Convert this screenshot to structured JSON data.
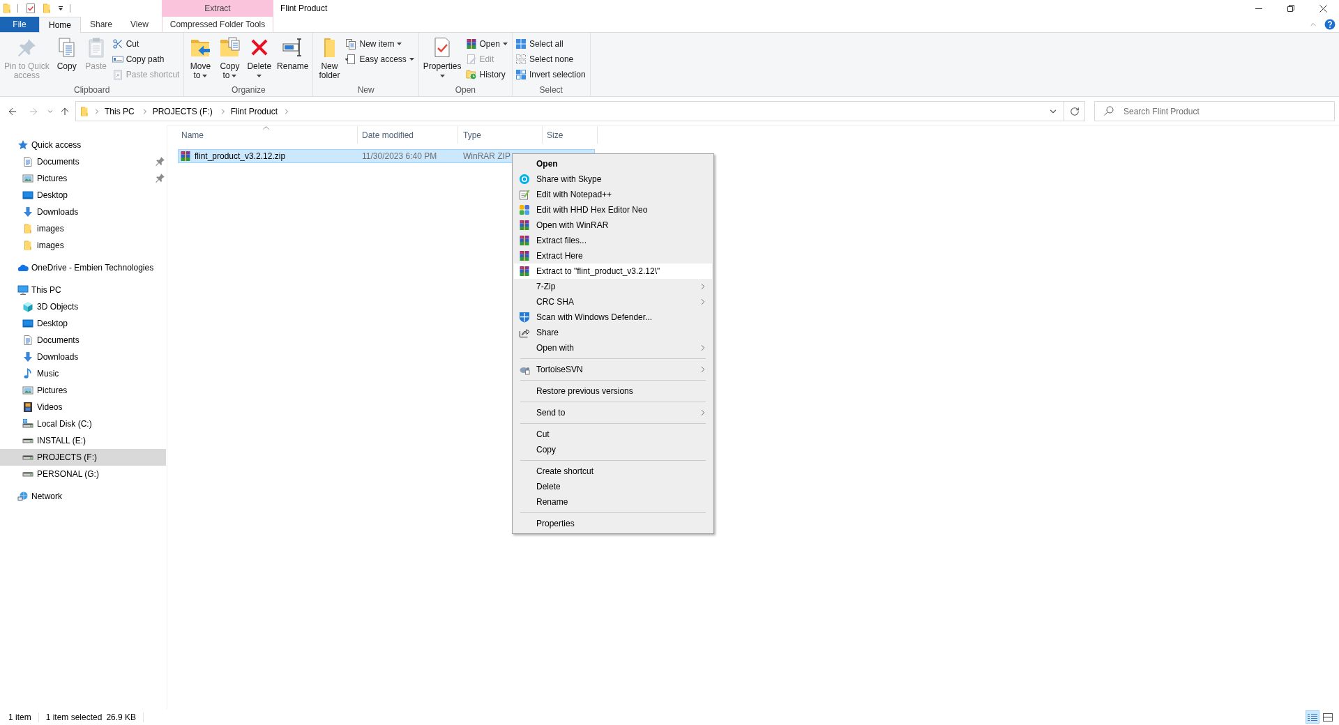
{
  "title_bar": {
    "contextual_group": "Extract",
    "title": "Flint Product"
  },
  "ribbon_tabs": [
    {
      "label": "File",
      "kind": "file",
      "selected": false
    },
    {
      "label": "Home",
      "kind": "tab",
      "selected": true
    },
    {
      "label": "Share",
      "kind": "tab",
      "selected": false
    },
    {
      "label": "View",
      "kind": "tab",
      "selected": false
    },
    {
      "label": "Compressed Folder Tools",
      "kind": "contextual",
      "selected": false
    }
  ],
  "ribbon_groups": [
    {
      "label": "Clipboard",
      "buttons": [
        {
          "label": "Pin to Quick access",
          "kind": "large",
          "disabled": true,
          "dropdown": false
        },
        {
          "label": "Copy",
          "kind": "large",
          "disabled": false,
          "dropdown": false
        },
        {
          "label": "Paste",
          "kind": "large",
          "disabled": true,
          "dropdown": false
        },
        {
          "label": "Cut",
          "kind": "small",
          "disabled": false,
          "dropdown": false
        },
        {
          "label": "Copy path",
          "kind": "small",
          "disabled": false,
          "dropdown": false
        },
        {
          "label": "Paste shortcut",
          "kind": "small",
          "disabled": true,
          "dropdown": false
        }
      ]
    },
    {
      "label": "Organize",
      "buttons": [
        {
          "label": "Move to",
          "kind": "large",
          "disabled": false,
          "dropdown": true
        },
        {
          "label": "Copy to",
          "kind": "large",
          "disabled": false,
          "dropdown": true
        },
        {
          "label": "Delete",
          "kind": "large",
          "disabled": false,
          "dropdown": true
        },
        {
          "label": "Rename",
          "kind": "large",
          "disabled": false,
          "dropdown": false
        }
      ]
    },
    {
      "label": "New",
      "buttons": [
        {
          "label": "New folder",
          "kind": "large",
          "disabled": false,
          "dropdown": false
        },
        {
          "label": "New item",
          "kind": "small",
          "disabled": false,
          "dropdown": true
        },
        {
          "label": "Easy access",
          "kind": "small",
          "disabled": false,
          "dropdown": true
        }
      ]
    },
    {
      "label": "Open",
      "buttons": [
        {
          "label": "Properties",
          "kind": "large",
          "disabled": false,
          "dropdown": true
        },
        {
          "label": "Open",
          "kind": "small",
          "disabled": false,
          "dropdown": true
        },
        {
          "label": "Edit",
          "kind": "small",
          "disabled": true,
          "dropdown": false
        },
        {
          "label": "History",
          "kind": "small",
          "disabled": false,
          "dropdown": false
        }
      ]
    },
    {
      "label": "Select",
      "buttons": [
        {
          "label": "Select all",
          "kind": "small",
          "disabled": false,
          "dropdown": false
        },
        {
          "label": "Select none",
          "kind": "small",
          "disabled": false,
          "dropdown": false
        },
        {
          "label": "Invert selection",
          "kind": "small",
          "disabled": false,
          "dropdown": false
        }
      ]
    }
  ],
  "navigation": {
    "back": {
      "disabled": false
    },
    "forward": {
      "disabled": true
    }
  },
  "address_bar": {
    "breadcrumbs": [
      "This PC",
      "PROJECTS (F:)",
      "Flint Product"
    ]
  },
  "search": {
    "placeholder": "Search Flint Product"
  },
  "navigation_pane": [
    {
      "label": "Quick access",
      "selected": false,
      "children": [
        {
          "label": "Documents",
          "selected": false,
          "pinned": true
        },
        {
          "label": "Pictures",
          "selected": false,
          "pinned": true
        },
        {
          "label": "Desktop",
          "selected": false,
          "pinned": false
        },
        {
          "label": "Downloads",
          "selected": false,
          "pinned": false
        },
        {
          "label": "images",
          "selected": false,
          "pinned": false
        },
        {
          "label": "images",
          "selected": false,
          "pinned": false
        }
      ]
    },
    {
      "label": "OneDrive - Embien Technologies",
      "selected": false
    },
    {
      "label": "This PC",
      "selected": false,
      "children": [
        {
          "label": "3D Objects",
          "selected": false
        },
        {
          "label": "Desktop",
          "selected": false
        },
        {
          "label": "Documents",
          "selected": false
        },
        {
          "label": "Downloads",
          "selected": false
        },
        {
          "label": "Music",
          "selected": false
        },
        {
          "label": "Pictures",
          "selected": false
        },
        {
          "label": "Videos",
          "selected": false
        },
        {
          "label": "Local Disk (C:)",
          "selected": false
        },
        {
          "label": "INSTALL (E:)",
          "selected": false
        },
        {
          "label": "PROJECTS (F:)",
          "selected": true
        },
        {
          "label": "PERSONAL (G:)",
          "selected": false
        }
      ]
    },
    {
      "label": "Network",
      "selected": false
    }
  ],
  "file_list": {
    "columns": [
      {
        "label": "Name",
        "sorted": true
      },
      {
        "label": "Date modified",
        "sorted": false
      },
      {
        "label": "Type",
        "sorted": false
      },
      {
        "label": "Size",
        "sorted": false
      }
    ],
    "rows": [
      {
        "name": "flint_product_v3.2.12.zip",
        "date_modified": "11/30/2023 6:40 PM",
        "type": "WinRAR ZIP",
        "selected": true
      }
    ]
  },
  "context_menu": {
    "sections": [
      {
        "items": [
          {
            "label": "Open",
            "default": true,
            "submenu": false,
            "highlighted": false
          },
          {
            "label": "Share with Skype",
            "default": false,
            "submenu": false,
            "highlighted": false
          },
          {
            "label": "Edit with Notepad++",
            "default": false,
            "submenu": false,
            "highlighted": false
          },
          {
            "label": "Edit with HHD Hex Editor Neo",
            "default": false,
            "submenu": false,
            "highlighted": false
          },
          {
            "label": "Open with WinRAR",
            "default": false,
            "submenu": false,
            "highlighted": false
          },
          {
            "label": "Extract files...",
            "default": false,
            "submenu": false,
            "highlighted": false
          },
          {
            "label": "Extract Here",
            "default": false,
            "submenu": false,
            "highlighted": false
          },
          {
            "label": "Extract to \"flint_product_v3.2.12\\\"",
            "default": false,
            "submenu": false,
            "highlighted": true
          },
          {
            "label": "7-Zip",
            "default": false,
            "submenu": true,
            "highlighted": false
          },
          {
            "label": "CRC SHA",
            "default": false,
            "submenu": true,
            "highlighted": false
          },
          {
            "label": "Scan with Windows Defender...",
            "default": false,
            "submenu": false,
            "highlighted": false
          },
          {
            "label": "Share",
            "default": false,
            "submenu": false,
            "highlighted": false
          },
          {
            "label": "Open with",
            "default": false,
            "submenu": true,
            "highlighted": false
          }
        ]
      },
      {
        "items": [
          {
            "label": "TortoiseSVN",
            "default": false,
            "submenu": true,
            "highlighted": false
          }
        ]
      },
      {
        "items": [
          {
            "label": "Restore previous versions",
            "default": false,
            "submenu": false,
            "highlighted": false
          }
        ]
      },
      {
        "items": [
          {
            "label": "Send to",
            "default": false,
            "submenu": true,
            "highlighted": false
          }
        ]
      },
      {
        "items": [
          {
            "label": "Cut",
            "default": false,
            "submenu": false,
            "highlighted": false
          },
          {
            "label": "Copy",
            "default": false,
            "submenu": false,
            "highlighted": false
          }
        ]
      },
      {
        "items": [
          {
            "label": "Create shortcut",
            "default": false,
            "submenu": false,
            "highlighted": false
          },
          {
            "label": "Delete",
            "default": false,
            "submenu": false,
            "highlighted": false
          },
          {
            "label": "Rename",
            "default": false,
            "submenu": false,
            "highlighted": false
          }
        ]
      },
      {
        "items": [
          {
            "label": "Properties",
            "default": false,
            "submenu": false,
            "highlighted": false
          }
        ]
      }
    ]
  },
  "status_bar": {
    "item_count": "1 item",
    "selection": "1 item selected",
    "selection_size": "26.9 KB",
    "view_modes": [
      {
        "selected": true
      },
      {
        "selected": false
      }
    ]
  }
}
